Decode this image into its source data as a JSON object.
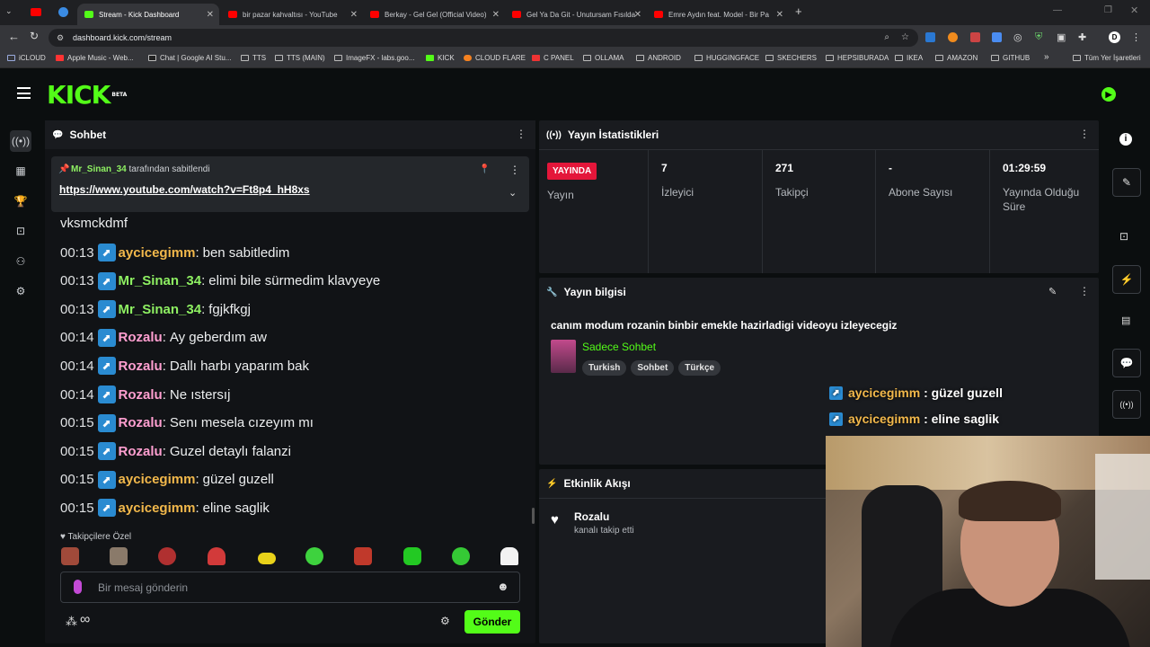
{
  "browser": {
    "tabs": [
      {
        "label": "Stream - Kick Dashboard",
        "active": true
      },
      {
        "label": "bir pazar kahvaltısı - YouTube"
      },
      {
        "label": "Berkay - Gel Gel (Official Video)"
      },
      {
        "label": "Gel Ya Da Git - Unutursam Fısılda"
      },
      {
        "label": "Emre Aydın feat. Model - Bir Pa"
      }
    ],
    "url": "dashboard.kick.com/stream",
    "bookmarks": [
      "iCLOUD",
      "Apple Music - Web...",
      "Chat | Google AI Stu...",
      "TTS",
      "TTS (MAIN)",
      "ImageFX - labs.goo...",
      "KICK",
      "CLOUD FLARE",
      "C PANEL",
      "OLLAMA",
      "ANDROID",
      "HUGGINGFACE",
      "SKECHERS",
      "HEPSIBURADA",
      "IKEA",
      "AMAZON",
      "GITHUB",
      "»",
      "Tüm Yer İşaretleri"
    ]
  },
  "app": {
    "logo": "KICK",
    "logo_badge": "BETA"
  },
  "chat": {
    "title": "Sohbet",
    "pinned_by_user": "Mr_Sinan_34",
    "pinned_by_suffix": "tarafından sabitlendi",
    "pinned_link": "https://www.youtube.com/watch?v=Ft8p4_hH8xs",
    "plain_line": "vksmckdmf",
    "messages": [
      {
        "time": "00:13",
        "user": "aycicegimm",
        "text": "ben sabitledim",
        "color": "#f2b84b"
      },
      {
        "time": "00:13",
        "user": "Mr_Sinan_34",
        "text": "elimi bile sürmedim klavyeye",
        "color": "#8ef062"
      },
      {
        "time": "00:13",
        "user": "Mr_Sinan_34",
        "text": "fgjkfkgj",
        "color": "#8ef062"
      },
      {
        "time": "00:14",
        "user": "Rozalu",
        "text": "Ay geberdım aw",
        "color": "#ff9fd0"
      },
      {
        "time": "00:14",
        "user": "Rozalu",
        "text": "Dallı harbı yaparım bak",
        "color": "#ff9fd0"
      },
      {
        "time": "00:14",
        "user": "Rozalu",
        "text": "Ne ıstersıj",
        "color": "#ff9fd0"
      },
      {
        "time": "00:15",
        "user": "Rozalu",
        "text": "Senı mesela cızeyım mı",
        "color": "#ff9fd0"
      },
      {
        "time": "00:15",
        "user": "Rozalu",
        "text": "Guzel detaylı falanzi",
        "color": "#ff9fd0"
      },
      {
        "time": "00:15",
        "user": "aycicegimm",
        "text": "güzel guzell",
        "color": "#f2b84b"
      },
      {
        "time": "00:15",
        "user": "aycicegimm",
        "text": "eline saglik",
        "color": "#f2b84b"
      }
    ],
    "emote_section": "Takipçilere Özel",
    "input_placeholder": "Bir mesaj gönderin",
    "send_label": "Gönder"
  },
  "stats": {
    "title": "Yayın İstatistikleri",
    "live_badge": "YAYINDA",
    "live_label": "Yayın",
    "items": [
      {
        "value": "7",
        "label": "İzleyici"
      },
      {
        "value": "271",
        "label": "Takipçi"
      },
      {
        "value": "-",
        "label": "Abone Sayısı"
      },
      {
        "value": "01:29:59",
        "label": "Yayında Olduğu Süre"
      }
    ]
  },
  "stream_info": {
    "title": "Yayın bilgisi",
    "stream_title": "canım modum rozanin binbir emekle hazirladigi videoyu izleyecegiz",
    "category": "Sadece Sohbet",
    "tags": [
      "Turkish",
      "Sohbet",
      "Türkçe"
    ]
  },
  "overlay_chat": [
    {
      "user": "aycicegimm",
      "text": ": güzel guzell"
    },
    {
      "user": "aycicegimm",
      "text": ": eline saglik"
    }
  ],
  "activity": {
    "title": "Etkinlik Akışı",
    "items": [
      {
        "user": "Rozalu",
        "action": "kanalı takip etti"
      }
    ]
  },
  "colors": {
    "accent": "#53fc18",
    "live": "#e4163a",
    "badge": "#2a8bd1"
  }
}
